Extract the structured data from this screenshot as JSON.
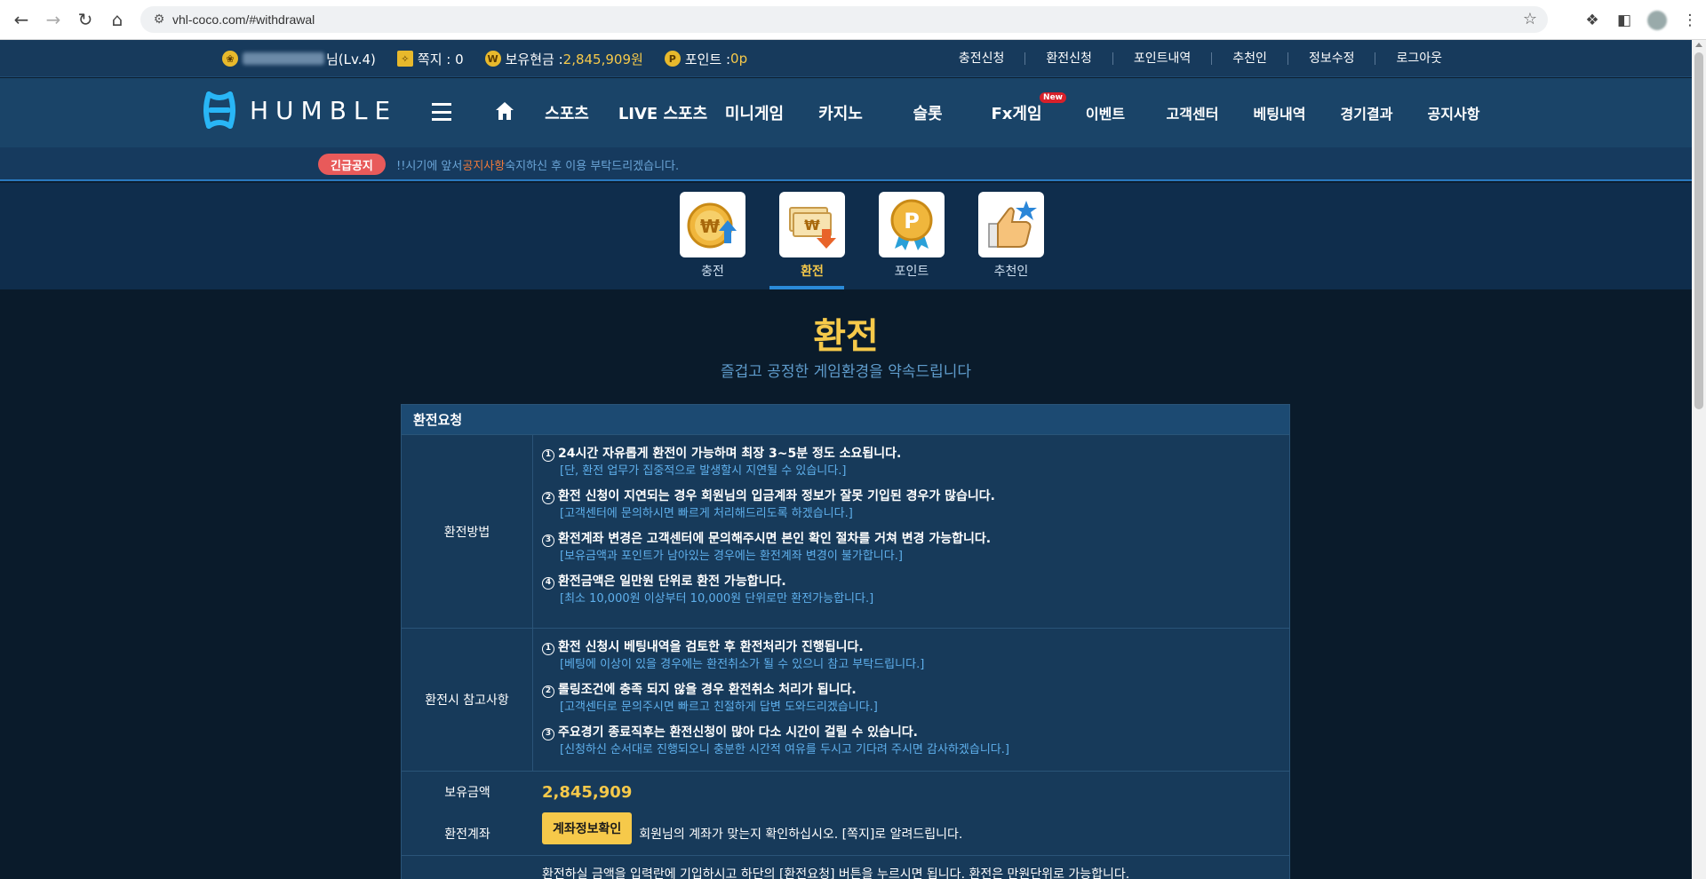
{
  "browser": {
    "url": "vhl-coco.com/#withdrawal"
  },
  "topbar": {
    "user_suffix": "님(Lv.4)",
    "memo": "쪽지 : 0",
    "cash_label": "보유현금 : ",
    "cash_value": "2,845,909원",
    "point_label": "포인트 : ",
    "point_value": "0p",
    "links": [
      "충전신청",
      "환전신청",
      "포인트내역",
      "추천인",
      "정보수정",
      "로그아웃"
    ]
  },
  "nav": {
    "logo_text": "HUMBLE",
    "menu": [
      {
        "label": "스포츠",
        "new": false
      },
      {
        "label": "LIVE 스포츠",
        "new": false
      },
      {
        "label": "미니게임",
        "new": false
      },
      {
        "label": "카지노",
        "new": false
      },
      {
        "label": "슬롯",
        "new": false
      },
      {
        "label": "Fx게임",
        "new": true
      },
      {
        "label": "이벤트",
        "new": false
      },
      {
        "label": "고객센터",
        "new": false
      },
      {
        "label": "베팅내역",
        "new": false
      },
      {
        "label": "경기결과",
        "new": false
      },
      {
        "label": "공지사항",
        "new": false
      }
    ],
    "new_tag": "New"
  },
  "notice": {
    "tag": "긴급공지",
    "msg_before": "!!시기에 앞서 ",
    "msg_highlight": "공지사항",
    "msg_after": " 숙지하신 후 이용 부탁드리겠습니다."
  },
  "money_tabs": [
    {
      "label": "충전",
      "icon": "coin-deposit-icon",
      "active": false
    },
    {
      "label": "환전",
      "icon": "cash-withdraw-icon",
      "active": true
    },
    {
      "label": "포인트",
      "icon": "point-medal-icon",
      "active": false
    },
    {
      "label": "추천인",
      "icon": "thumbs-up-icon",
      "active": false
    }
  ],
  "page": {
    "title": "환전",
    "subtitle": "즐겁고 공정한 게임환경을 약속드립니다"
  },
  "panel": {
    "header": "환전요청",
    "method_label": "환전방법",
    "method_items": [
      {
        "n": "1",
        "text": "24시간 자유롭게 환전이 가능하며 최장 3~5분 정도 소요됩니다.",
        "sub": "[단, 환전 업무가 집중적으로 발생할시 지연될 수 있습니다.]"
      },
      {
        "n": "2",
        "text": "환전 신청이 지연되는 경우 회원님의 입금계좌 정보가 잘못 기입된 경우가 많습니다.",
        "sub": "[고객센터에 문의하시면 빠르게 처리해드리도록 하겠습니다.]"
      },
      {
        "n": "3",
        "text": "환전계좌 변경은 고객센터에 문의해주시면 본인 확인 절차를 거쳐 변경 가능합니다.",
        "sub": "[보유금액과 포인트가 남아있는 경우에는 환전계좌 변경이 불가합니다.]"
      },
      {
        "n": "4",
        "text": "환전금액은 일만원 단위로 환전 가능합니다.",
        "sub": "[최소 10,000원 이상부터 10,000원 단위로만 환전가능합니다.]"
      }
    ],
    "notes_label": "환전시 참고사항",
    "notes_items": [
      {
        "n": "1",
        "text": "환전 신청시 베팅내역을 검토한 후 환전처리가 진행됩니다.",
        "sub": "[베팅에 이상이 있을 경우에는 환전취소가 될 수 있으니 참고 부탁드립니다.]"
      },
      {
        "n": "2",
        "text": "롤링조건에 충족 되지 않을 경우 환전취소 처리가 됩니다.",
        "sub": "[고객센터로 문의주시면 빠르고 친절하게 답변 도와드리겠습니다.]"
      },
      {
        "n": "3",
        "text": "주요경기 종료직후는 환전신청이 많아 다소 시간이 걸릴 수 있습니다.",
        "sub": "[신청하신 순서대로 진행되오니 충분한 시간적 여유를 두시고 기다려 주시면 감사하겠습니다.]"
      }
    ],
    "balance_label": "보유금액",
    "balance_value": "2,845,909",
    "account_label": "환전계좌",
    "account_button": "계좌정보확인",
    "account_text": "회원님의 계좌가 맞는지 확인하십시오. [쪽지]로 알려드립니다.",
    "bottom_text": "환전하실 금액을 입력란에 기입하시고 하단의 [환전요청] 버튼을 누르시면 됩니다. 환전은 만원단위로 가능합니다."
  },
  "colors": {
    "accent_yellow": "#f6c94a",
    "nav_bg": "#1a4468",
    "info_blue": "#5fb0ec",
    "notice_red": "#e85a5a"
  }
}
